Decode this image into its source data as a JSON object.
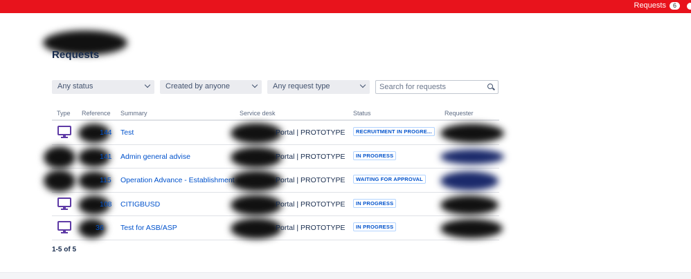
{
  "topbar": {
    "requests_label": "Requests",
    "requests_count": "6",
    "accent_color": "#e8131c"
  },
  "page": {
    "title": "Requests"
  },
  "filters": {
    "status": "Any status",
    "created_by": "Created by anyone",
    "request_type": "Any request type",
    "search_placeholder": "Search for requests"
  },
  "table": {
    "headers": [
      "Type",
      "Reference",
      "Summary",
      "Service desk",
      "Status",
      "Requester"
    ],
    "rows": [
      {
        "type_icon": "monitor-icon",
        "reference": "144",
        "summary": "Test",
        "service_desk": "Portal | PROTOTYPE",
        "status": "RECRUITMENT IN PROGRE..."
      },
      {
        "type_icon": "",
        "reference": "141",
        "summary": "Admin general advise",
        "service_desk": "Portal | PROTOTYPE",
        "status": "IN PROGRESS"
      },
      {
        "type_icon": "",
        "reference": "115",
        "summary": "Operation Advance - Establishment",
        "service_desk": "Portal | PROTOTYPE",
        "status": "WAITING FOR APPROVAL"
      },
      {
        "type_icon": "monitor-icon",
        "reference": "108",
        "summary": "CITIGBUSD",
        "service_desk": "Portal | PROTOTYPE",
        "status": "IN PROGRESS"
      },
      {
        "type_icon": "monitor-icon",
        "reference": "36",
        "summary": "Test for ASB/ASP",
        "service_desk": "Portal | PROTOTYPE",
        "status": "IN PROGRESS"
      }
    ]
  },
  "pagination": {
    "label": "1-5 of 5"
  }
}
